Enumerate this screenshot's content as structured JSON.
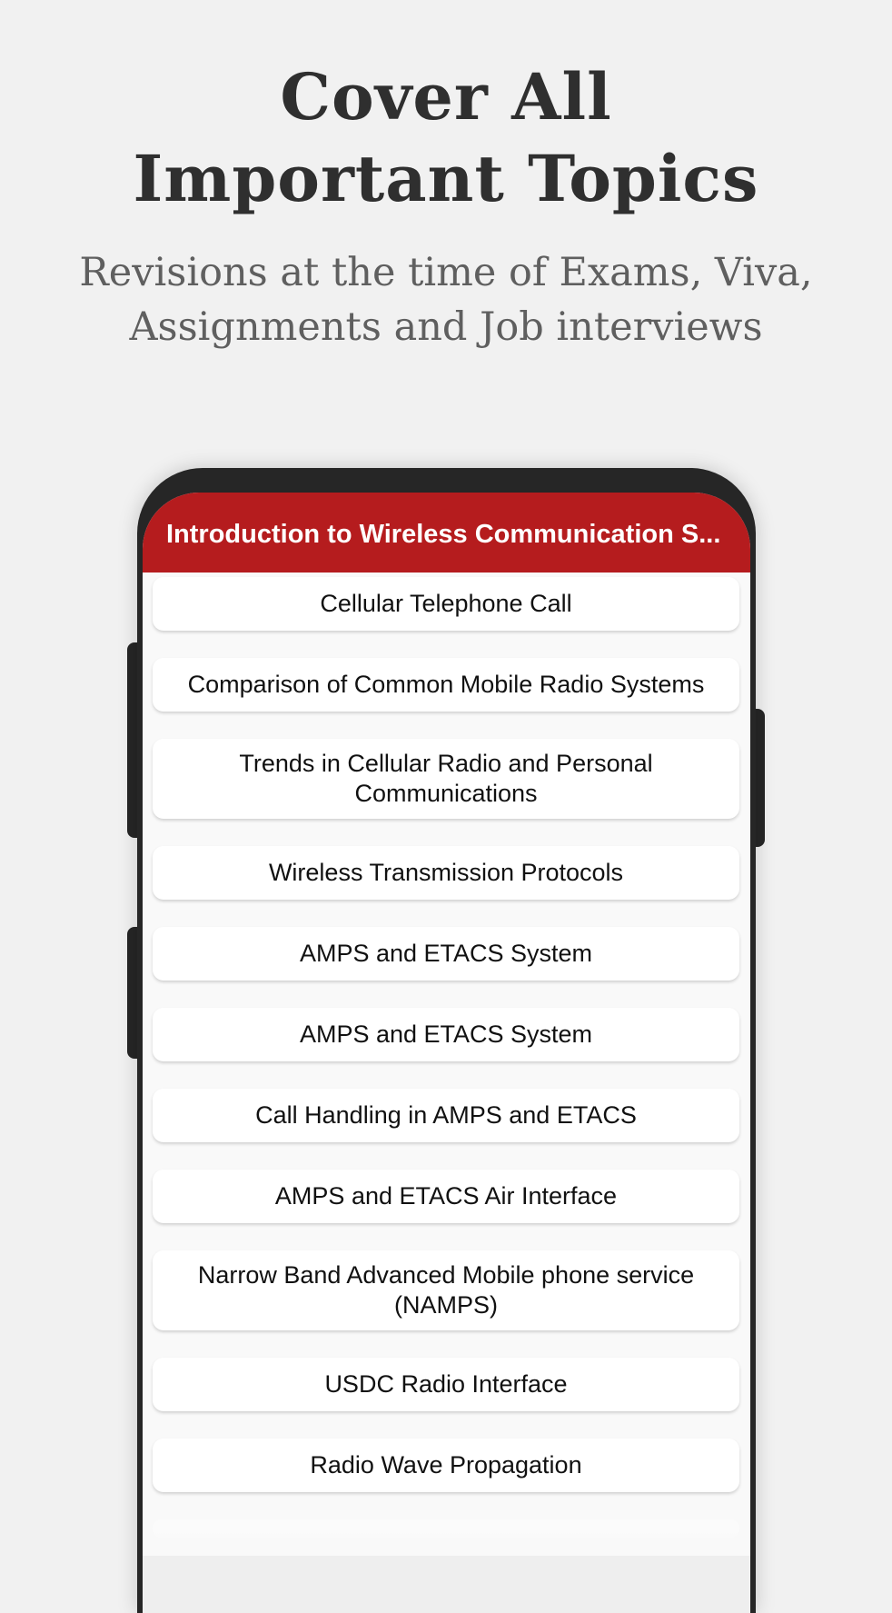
{
  "promo": {
    "headline_line1": "Cover All",
    "headline_line2": "Important Topics",
    "subline_line1": "Revisions at the time of Exams, Viva,",
    "subline_line2": "Assignments and Job interviews"
  },
  "app": {
    "accent_color": "#b51c1e",
    "appbar_title": "Introduction to Wireless Communication S...",
    "topics": [
      "Cellular Telephone Call",
      "Comparison of Common Mobile Radio Systems",
      "Trends in Cellular Radio and Personal Communications",
      "Wireless Transmission Protocols",
      "AMPS and ETACS System",
      "AMPS and ETACS System",
      "Call Handling in AMPS and ETACS",
      "AMPS and ETACS Air Interface",
      "Narrow Band Advanced Mobile phone service (NAMPS)",
      "USDC Radio Interface",
      "Radio Wave Propagation"
    ]
  }
}
